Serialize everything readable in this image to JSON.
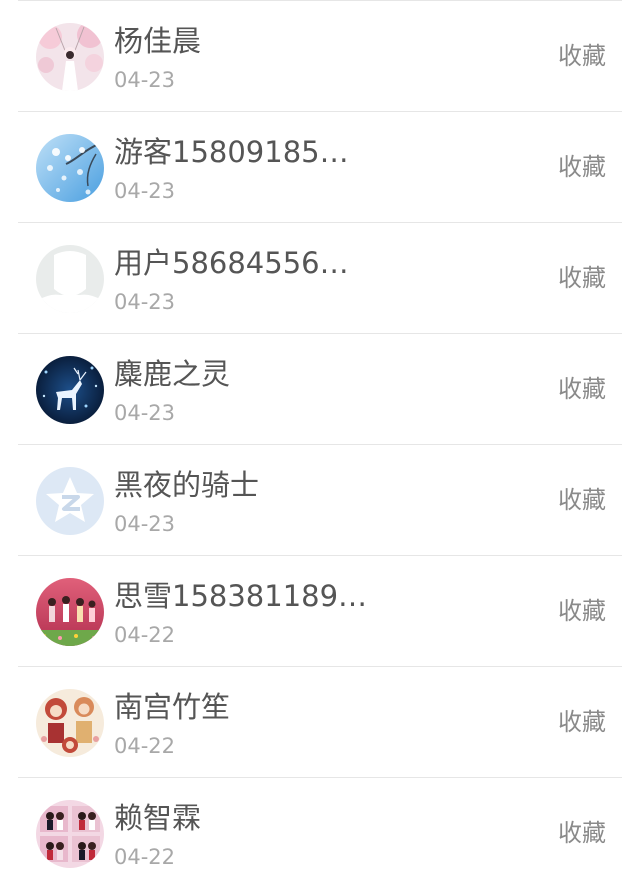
{
  "entries": [
    {
      "name": "杨佳晨",
      "date": "04-23",
      "action": "收藏",
      "avatar_icon": "avatar-blossom-girl"
    },
    {
      "name": "游客15809185…",
      "date": "04-23",
      "action": "收藏",
      "avatar_icon": "avatar-blue-blossom"
    },
    {
      "name": "用户58684556…",
      "date": "04-23",
      "action": "收藏",
      "avatar_icon": "avatar-default-silhouette"
    },
    {
      "name": "麋鹿之灵",
      "date": "04-23",
      "action": "收藏",
      "avatar_icon": "avatar-night-deer"
    },
    {
      "name": "黑夜的骑士",
      "date": "04-23",
      "action": "收藏",
      "avatar_icon": "avatar-qzone-star"
    },
    {
      "name": "思雪158381189…",
      "date": "04-22",
      "action": "收藏",
      "avatar_icon": "avatar-red-figures"
    },
    {
      "name": "南宫竹笙",
      "date": "04-22",
      "action": "收藏",
      "avatar_icon": "avatar-illustration"
    },
    {
      "name": "赖智霖",
      "date": "04-22",
      "action": "收藏",
      "avatar_icon": "avatar-couple-photos"
    }
  ],
  "colors": {
    "name_text": "#555555",
    "date_text": "#a8a8a8",
    "action_text": "#8a8a8a",
    "divider": "#e6e6e6",
    "background": "#ffffff"
  }
}
